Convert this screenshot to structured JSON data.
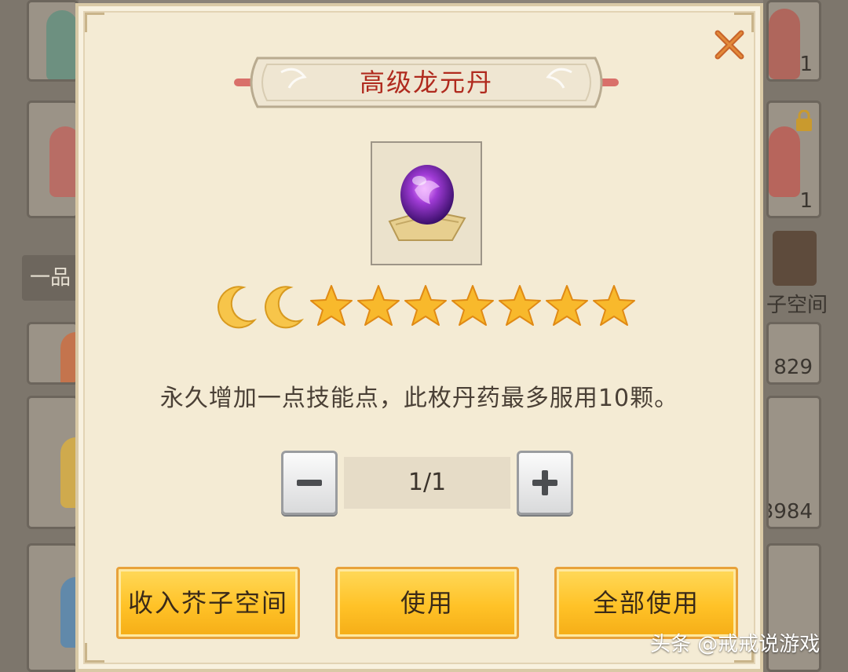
{
  "dialog": {
    "title": "高级龙元丹",
    "description": "永久增加一点技能点，此枚丹药最多服用10颗。",
    "item_icon": "purple-orb-on-scroll-icon",
    "rank": {
      "moons": 2,
      "stars": 7
    },
    "quantity": "1/1",
    "buttons": {
      "store": "收入芥子空间",
      "use": "使用",
      "use_all": "全部使用"
    },
    "colors": {
      "title": "#b02a1e",
      "button": "#ffc227",
      "panel": "#f4ebd4"
    }
  },
  "background": {
    "counts": [
      "1",
      "1",
      "829",
      "3984"
    ],
    "grade_label": "一品",
    "space_label": "子空间"
  },
  "watermark": "头条 @戒戒说游戏"
}
